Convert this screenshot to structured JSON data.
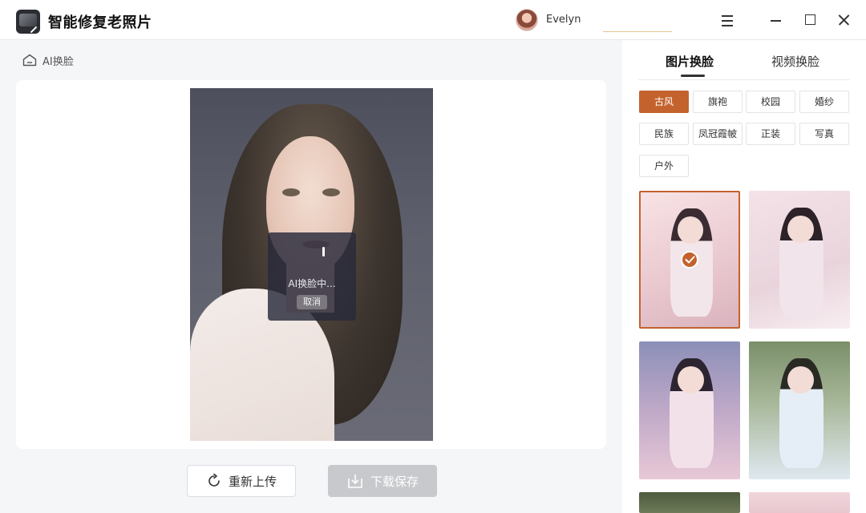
{
  "app": {
    "title": "智能修复老照片"
  },
  "user": {
    "name": "Evelyn"
  },
  "breadcrumb": {
    "label": "AI换脸"
  },
  "progress": {
    "status_text": "AI换脸中...",
    "cancel_label": "取消"
  },
  "actions": {
    "reupload_label": "重新上传",
    "download_label": "下载保存"
  },
  "tabs": [
    {
      "label": "图片换脸",
      "active": true
    },
    {
      "label": "视频换脸",
      "active": false
    }
  ],
  "tags": [
    {
      "label": "古风",
      "active": true
    },
    {
      "label": "旗袍",
      "active": false
    },
    {
      "label": "校园",
      "active": false
    },
    {
      "label": "婚纱",
      "active": false
    },
    {
      "label": "民族",
      "active": false
    },
    {
      "label": "凤冠霞帔",
      "active": false
    },
    {
      "label": "正装",
      "active": false
    },
    {
      "label": "写真",
      "active": false
    },
    {
      "label": "户外",
      "active": false
    }
  ],
  "templates": [
    {
      "id": "thumb-1",
      "selected": true,
      "palette": [
        "#f7e3e6",
        "#e9c7cf",
        "#3a2c32"
      ]
    },
    {
      "id": "thumb-2",
      "selected": false,
      "palette": [
        "#f4e2e8",
        "#e9d4dc",
        "#2c2228"
      ]
    },
    {
      "id": "thumb-3",
      "selected": false,
      "palette": [
        "#8c8fb8",
        "#e8c8d6",
        "#2c2430"
      ]
    },
    {
      "id": "thumb-4",
      "selected": false,
      "palette": [
        "#7a8f6a",
        "#dfe8f0",
        "#2a2a24"
      ]
    }
  ],
  "colors": {
    "accent": "#c4622d",
    "disabled": "#c8c9cd"
  }
}
